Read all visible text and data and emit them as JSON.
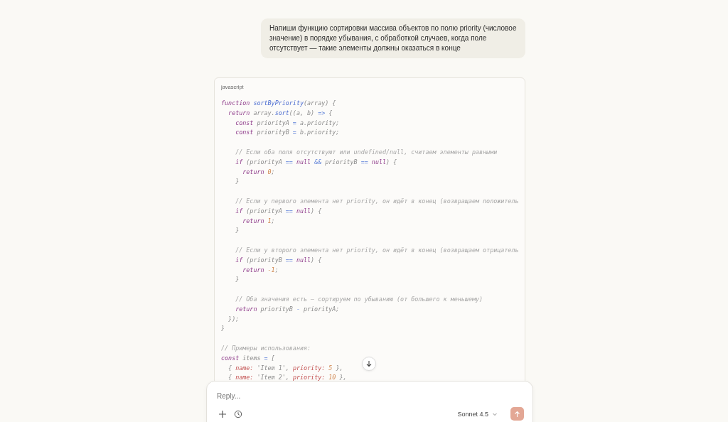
{
  "user_message": "Напиши функцию сортировки массива объектов по полю priority (числовое значение) в порядке убывания, с обработкой случаев, когда поле отсутствует — такие элементы должны оказаться в конце",
  "code_block": {
    "language": "javascript",
    "lines": [
      {
        "kind": "code",
        "tokens": [
          {
            "kind": "keyword",
            "text": "function "
          },
          {
            "kind": "function",
            "text": "sortByPriority"
          },
          {
            "kind": "plain",
            "text": "(array) {"
          }
        ]
      },
      {
        "kind": "code",
        "tokens": [
          {
            "kind": "keyword",
            "text": "  return"
          },
          {
            "kind": "plain",
            "text": " array."
          },
          {
            "kind": "function",
            "text": "sort"
          },
          {
            "kind": "plain",
            "text": "((a, b) "
          },
          {
            "kind": "operator",
            "text": "=>"
          },
          {
            "kind": "plain",
            "text": " {"
          }
        ]
      },
      {
        "kind": "code",
        "tokens": [
          {
            "kind": "keyword",
            "text": "    const"
          },
          {
            "kind": "plain",
            "text": " priorityA "
          },
          {
            "kind": "operator",
            "text": "="
          },
          {
            "kind": "plain",
            "text": " a.priority;"
          }
        ]
      },
      {
        "kind": "code",
        "tokens": [
          {
            "kind": "keyword",
            "text": "    const"
          },
          {
            "kind": "plain",
            "text": " priorityB "
          },
          {
            "kind": "operator",
            "text": "="
          },
          {
            "kind": "plain",
            "text": " b.priority;"
          }
        ]
      },
      {
        "kind": "blank"
      },
      {
        "kind": "code",
        "tokens": [
          {
            "kind": "comment",
            "text": "    // Если оба поля отсутствуют или undefined/null, считаем элементы равными"
          }
        ]
      },
      {
        "kind": "code",
        "tokens": [
          {
            "kind": "keyword",
            "text": "    if"
          },
          {
            "kind": "plain",
            "text": " (priorityA "
          },
          {
            "kind": "operator",
            "text": "== "
          },
          {
            "kind": "keyword",
            "text": "null "
          },
          {
            "kind": "operator",
            "text": "&&"
          },
          {
            "kind": "plain",
            "text": " priorityB "
          },
          {
            "kind": "operator",
            "text": "== "
          },
          {
            "kind": "keyword",
            "text": "null"
          },
          {
            "kind": "plain",
            "text": ") {"
          }
        ]
      },
      {
        "kind": "code",
        "tokens": [
          {
            "kind": "keyword",
            "text": "      return "
          },
          {
            "kind": "number",
            "text": "0"
          },
          {
            "kind": "plain",
            "text": ";"
          }
        ]
      },
      {
        "kind": "code",
        "tokens": [
          {
            "kind": "plain",
            "text": "    }"
          }
        ]
      },
      {
        "kind": "blank"
      },
      {
        "kind": "code",
        "tokens": [
          {
            "kind": "comment",
            "text": "    // Если у первого элемента нет priority, он идёт в конец (возвращаем положитель"
          }
        ]
      },
      {
        "kind": "code",
        "tokens": [
          {
            "kind": "keyword",
            "text": "    if"
          },
          {
            "kind": "plain",
            "text": " (priorityA "
          },
          {
            "kind": "operator",
            "text": "== "
          },
          {
            "kind": "keyword",
            "text": "null"
          },
          {
            "kind": "plain",
            "text": ") {"
          }
        ]
      },
      {
        "kind": "code",
        "tokens": [
          {
            "kind": "keyword",
            "text": "      return "
          },
          {
            "kind": "number",
            "text": "1"
          },
          {
            "kind": "plain",
            "text": ";"
          }
        ]
      },
      {
        "kind": "code",
        "tokens": [
          {
            "kind": "plain",
            "text": "    }"
          }
        ]
      },
      {
        "kind": "blank"
      },
      {
        "kind": "code",
        "tokens": [
          {
            "kind": "comment",
            "text": "    // Если у второго элемента нет priority, он идёт в конец (возвращаем отрицатель"
          }
        ]
      },
      {
        "kind": "code",
        "tokens": [
          {
            "kind": "keyword",
            "text": "    if"
          },
          {
            "kind": "plain",
            "text": " (priorityB "
          },
          {
            "kind": "operator",
            "text": "== "
          },
          {
            "kind": "keyword",
            "text": "null"
          },
          {
            "kind": "plain",
            "text": ") {"
          }
        ]
      },
      {
        "kind": "code",
        "tokens": [
          {
            "kind": "keyword",
            "text": "      return "
          },
          {
            "kind": "number",
            "text": "-1"
          },
          {
            "kind": "plain",
            "text": ";"
          }
        ]
      },
      {
        "kind": "code",
        "tokens": [
          {
            "kind": "plain",
            "text": "    }"
          }
        ]
      },
      {
        "kind": "blank"
      },
      {
        "kind": "code",
        "tokens": [
          {
            "kind": "comment",
            "text": "    // Оба значения есть — сортируем по убыванию (от большего к меньшему)"
          }
        ]
      },
      {
        "kind": "code",
        "tokens": [
          {
            "kind": "keyword",
            "text": "    return"
          },
          {
            "kind": "plain",
            "text": " priorityB "
          },
          {
            "kind": "operator",
            "text": "-"
          },
          {
            "kind": "plain",
            "text": " priorityA;"
          }
        ]
      },
      {
        "kind": "code",
        "tokens": [
          {
            "kind": "plain",
            "text": "  });"
          }
        ]
      },
      {
        "kind": "code",
        "tokens": [
          {
            "kind": "plain",
            "text": "}"
          }
        ]
      },
      {
        "kind": "blank"
      },
      {
        "kind": "code",
        "tokens": [
          {
            "kind": "comment",
            "text": "// Примеры использования:"
          }
        ]
      },
      {
        "kind": "code",
        "tokens": [
          {
            "kind": "keyword",
            "text": "const"
          },
          {
            "kind": "plain",
            "text": " items "
          },
          {
            "kind": "operator",
            "text": "="
          },
          {
            "kind": "plain",
            "text": " ["
          }
        ]
      },
      {
        "kind": "code",
        "tokens": [
          {
            "kind": "plain",
            "text": "  { "
          },
          {
            "kind": "property",
            "text": "name:"
          },
          {
            "kind": "string",
            "text": " 'Item 1'"
          },
          {
            "kind": "plain",
            "text": ", "
          },
          {
            "kind": "property",
            "text": "priority:"
          },
          {
            "kind": "number",
            "text": " 5"
          },
          {
            "kind": "plain",
            "text": " },"
          }
        ]
      },
      {
        "kind": "code",
        "tokens": [
          {
            "kind": "plain",
            "text": "  { "
          },
          {
            "kind": "property",
            "text": "name:"
          },
          {
            "kind": "string",
            "text": " 'Item 2'"
          },
          {
            "kind": "plain",
            "text": ", "
          },
          {
            "kind": "property",
            "text": "priority:"
          },
          {
            "kind": "number",
            "text": " 10"
          },
          {
            "kind": "plain",
            "text": " },"
          }
        ]
      }
    ]
  },
  "composer": {
    "placeholder": "Reply...",
    "model": "Sonnet 4.5"
  }
}
